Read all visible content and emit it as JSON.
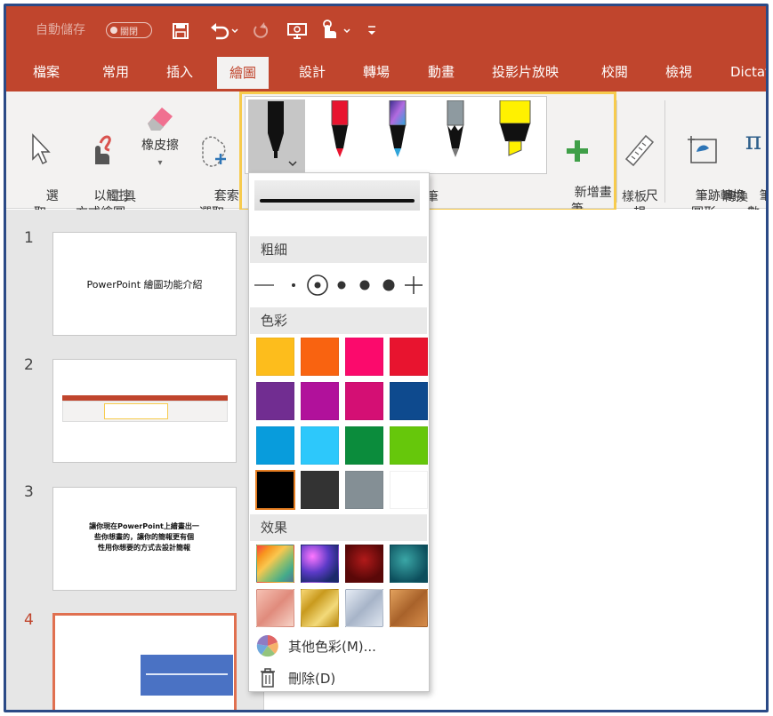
{
  "qat": {
    "autosave_label": "自動儲存",
    "autosave_state": "關閉"
  },
  "tabs": [
    {
      "label": "檔案"
    },
    {
      "label": "常用"
    },
    {
      "label": "插入"
    },
    {
      "label": "繪圖"
    },
    {
      "label": "設計"
    },
    {
      "label": "轉場"
    },
    {
      "label": "動畫"
    },
    {
      "label": "投影片放映"
    },
    {
      "label": "校閱"
    },
    {
      "label": "檢視"
    },
    {
      "label": "Dictat"
    }
  ],
  "ribbon": {
    "select_label": "選\n取",
    "touch_draw_label": "以觸控\n方式繪圖",
    "eraser_label": "橡皮擦",
    "lasso_label": "套索\n選取",
    "tools_group": "工具",
    "add_pen_label": "新增畫\n筆",
    "pens_group_partial": "筆",
    "ruler_label": "尺\n規",
    "stencils_group": "樣板",
    "ink_to_shape_label": "筆跡轉換\n圖形",
    "ink_to_math_label": "筆跡\n數",
    "convert_group": "轉換"
  },
  "dropdown": {
    "thickness_head": "粗細",
    "color_head": "色彩",
    "effects_head": "效果",
    "more_colors": "其他色彩(M)...",
    "delete": "刪除(D)",
    "colors": [
      "#fdbd1c",
      "#f96310",
      "#fb0a6c",
      "#e8142f",
      "#712d91",
      "#b1119b",
      "#d40f74",
      "#0e4a8e",
      "#089cdc",
      "#2dc8fb",
      "#0b8c3c",
      "#66c70b",
      "#000000",
      "#333333",
      "#848f95",
      "#ffffff"
    ],
    "selected_color": "#000000",
    "effects": [
      "rainbow",
      "galaxy",
      "lava",
      "ocean",
      "rose-gold",
      "gold",
      "silver",
      "bronze"
    ]
  },
  "slides": [
    {
      "num": "1",
      "text": "PowerPoint 繪圖功能介紹"
    },
    {
      "num": "2",
      "text": ""
    },
    {
      "num": "3",
      "text": "讓你現在PowerPoint上繪畫出一\n些你想畫的，讓你的簡報更有個\n性用你想要的方式去設計簡報"
    },
    {
      "num": "4",
      "text": ""
    }
  ]
}
